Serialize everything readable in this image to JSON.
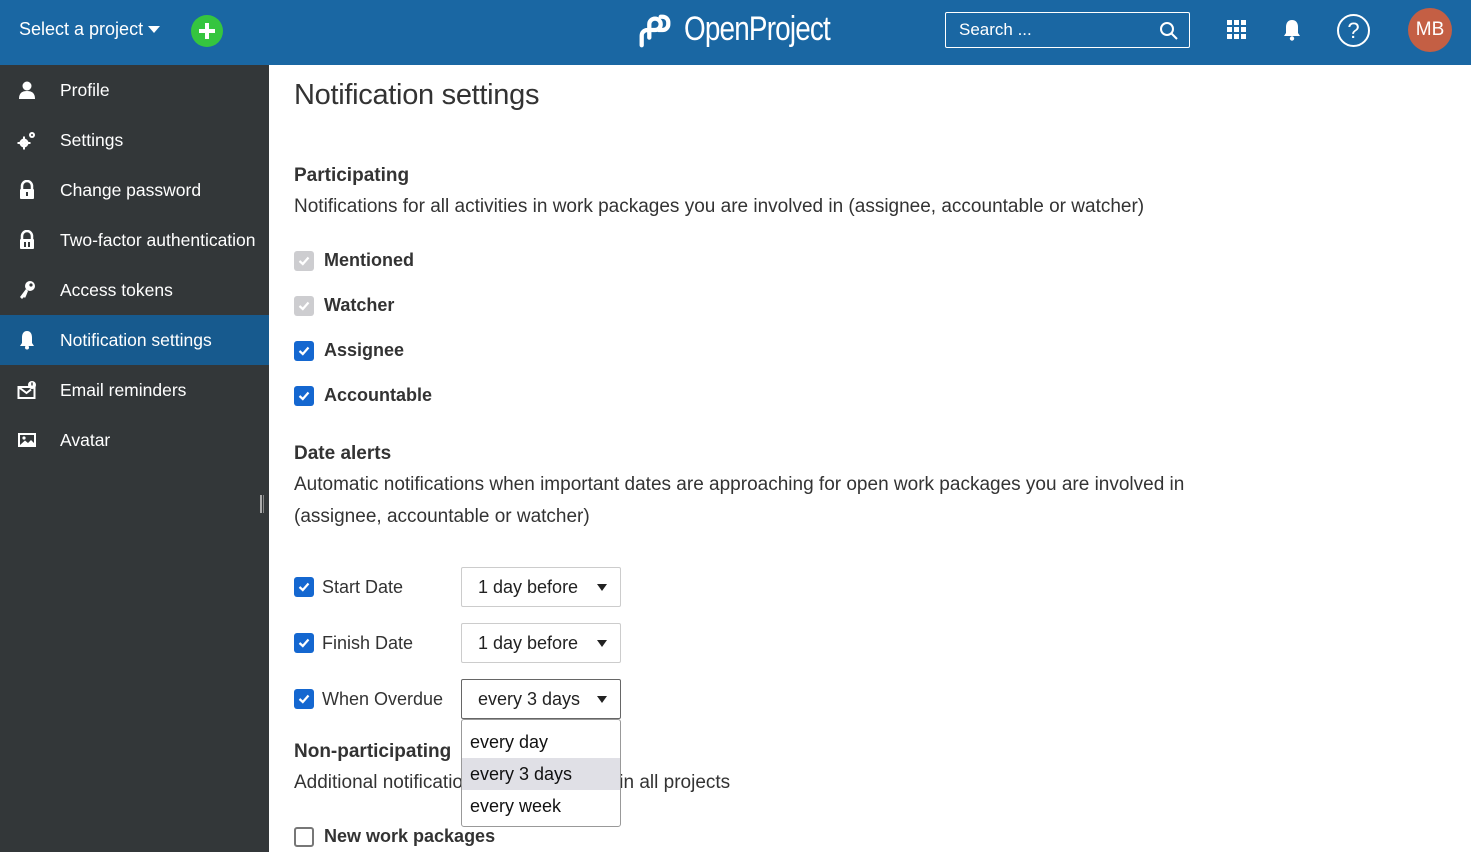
{
  "header": {
    "project_select_label": "Select a project",
    "add_button_icon": "plus-icon",
    "logo_text": "OpenProject",
    "search_placeholder": "Search ...",
    "search_value": "",
    "avatar_initials": "MB",
    "help_label": "?",
    "colors": {
      "bar": "#1a67a3",
      "add": "#35c53f",
      "avatar": "#c45f44"
    }
  },
  "sidebar": {
    "items": [
      {
        "label": "Profile",
        "icon": "user-icon",
        "active": false
      },
      {
        "label": "Settings",
        "icon": "gears-icon",
        "active": false
      },
      {
        "label": "Change password",
        "icon": "lock-icon",
        "active": false
      },
      {
        "label": "Two-factor authentication",
        "icon": "lock-2fa-icon",
        "active": false
      },
      {
        "label": "Access tokens",
        "icon": "key-icon",
        "active": false
      },
      {
        "label": "Notification settings",
        "icon": "bell-icon",
        "active": true
      },
      {
        "label": "Email reminders",
        "icon": "email-reminder-icon",
        "active": false
      },
      {
        "label": "Avatar",
        "icon": "image-icon",
        "active": false
      }
    ]
  },
  "main": {
    "page_title": "Notification settings",
    "participating": {
      "title": "Participating",
      "description": "Notifications for all activities in work packages you are involved in (assignee, accountable or watcher)",
      "options": [
        {
          "label": "Mentioned",
          "checked": true,
          "disabled": true
        },
        {
          "label": "Watcher",
          "checked": true,
          "disabled": true
        },
        {
          "label": "Assignee",
          "checked": true,
          "disabled": false
        },
        {
          "label": "Accountable",
          "checked": true,
          "disabled": false
        }
      ]
    },
    "date_alerts": {
      "title": "Date alerts",
      "description": "Automatic notifications when important dates are approaching for open work packages you are involved in (assignee, accountable or watcher)",
      "rows": [
        {
          "label": "Start Date",
          "checked": true,
          "value": "1 day before"
        },
        {
          "label": "Finish Date",
          "checked": true,
          "value": "1 day before"
        },
        {
          "label": "When Overdue",
          "checked": true,
          "value": "every 3 days"
        }
      ],
      "overdue_dropdown": {
        "options": [
          "every day",
          "every 3 days",
          "every week"
        ],
        "selected": "every 3 days"
      }
    },
    "non_participating": {
      "title": "Non-participating",
      "description": "Additional notifications about activities in all projects",
      "options": [
        {
          "label": "New work packages",
          "checked": false
        }
      ]
    }
  }
}
